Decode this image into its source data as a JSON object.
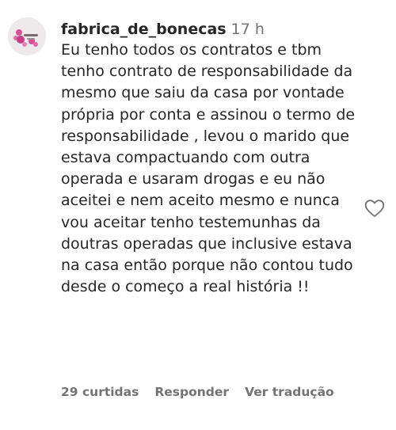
{
  "comment": {
    "username": "fabrica_de_bonecas",
    "time": "17 h",
    "text": "Eu tenho todos os contratos e tbm tenho contrato de responsabilidade da mesmo que saiu da casa por vontade própria por conta e assinou o termo de responsabilidade , levou o marido que estava compactuando com outra operada e usaram drogas e eu não aceitei e nem aceito mesmo e nunca vou aceitar tenho testemunhas da doutras operadas que inclusive estava na casa então porque não contou tudo desde o começo a real história !!",
    "likes": "29 curtidas",
    "reply": "Responder",
    "translate": "Ver tradução",
    "like_icon": "heart-outline-icon"
  },
  "colors": {
    "text": "#262626",
    "secondary": "#737373",
    "avatar_accent": "#d94f93"
  }
}
